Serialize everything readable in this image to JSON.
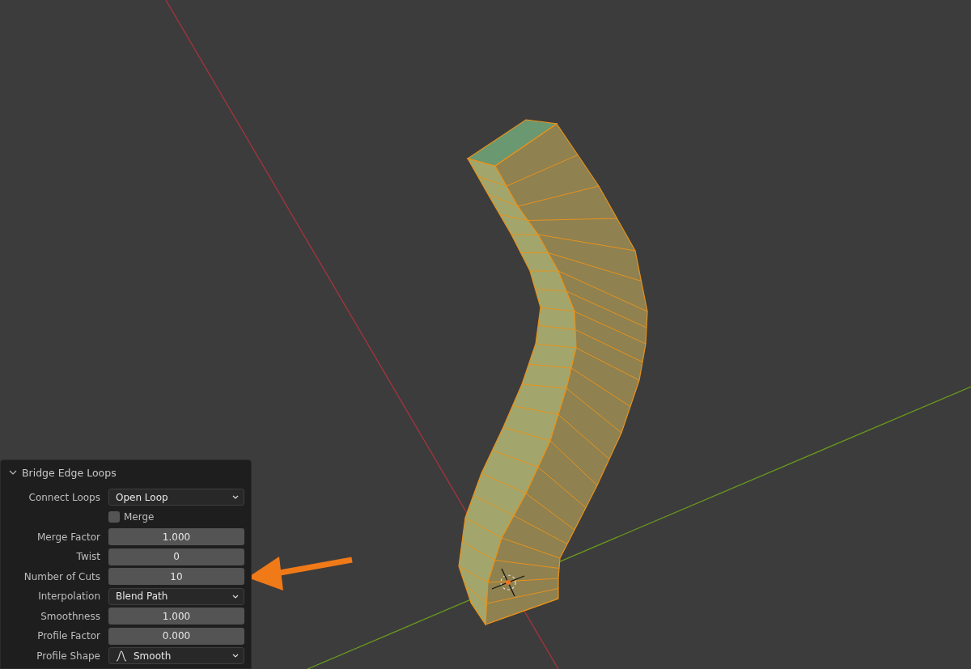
{
  "viewport": {
    "panel": {
      "title": "Bridge Edge Loops",
      "expanded": true,
      "rows": [
        {
          "kind": "dropdown",
          "label": "Connect Loops",
          "value": "Open Loop"
        },
        {
          "kind": "checkbox",
          "label": "Merge",
          "checked": false
        },
        {
          "kind": "number",
          "label": "Merge Factor",
          "value": "1.000"
        },
        {
          "kind": "number",
          "label": "Twist",
          "value": "0"
        },
        {
          "kind": "number",
          "label": "Number of Cuts",
          "value": "10"
        },
        {
          "kind": "dropdown",
          "label": "Interpolation",
          "value": "Blend Path"
        },
        {
          "kind": "number",
          "label": "Smoothness",
          "value": "1.000"
        },
        {
          "kind": "number",
          "label": "Profile Factor",
          "value": "0.000"
        },
        {
          "kind": "shape-dropdown",
          "label": "Profile Shape",
          "value": "Smooth"
        }
      ]
    }
  }
}
